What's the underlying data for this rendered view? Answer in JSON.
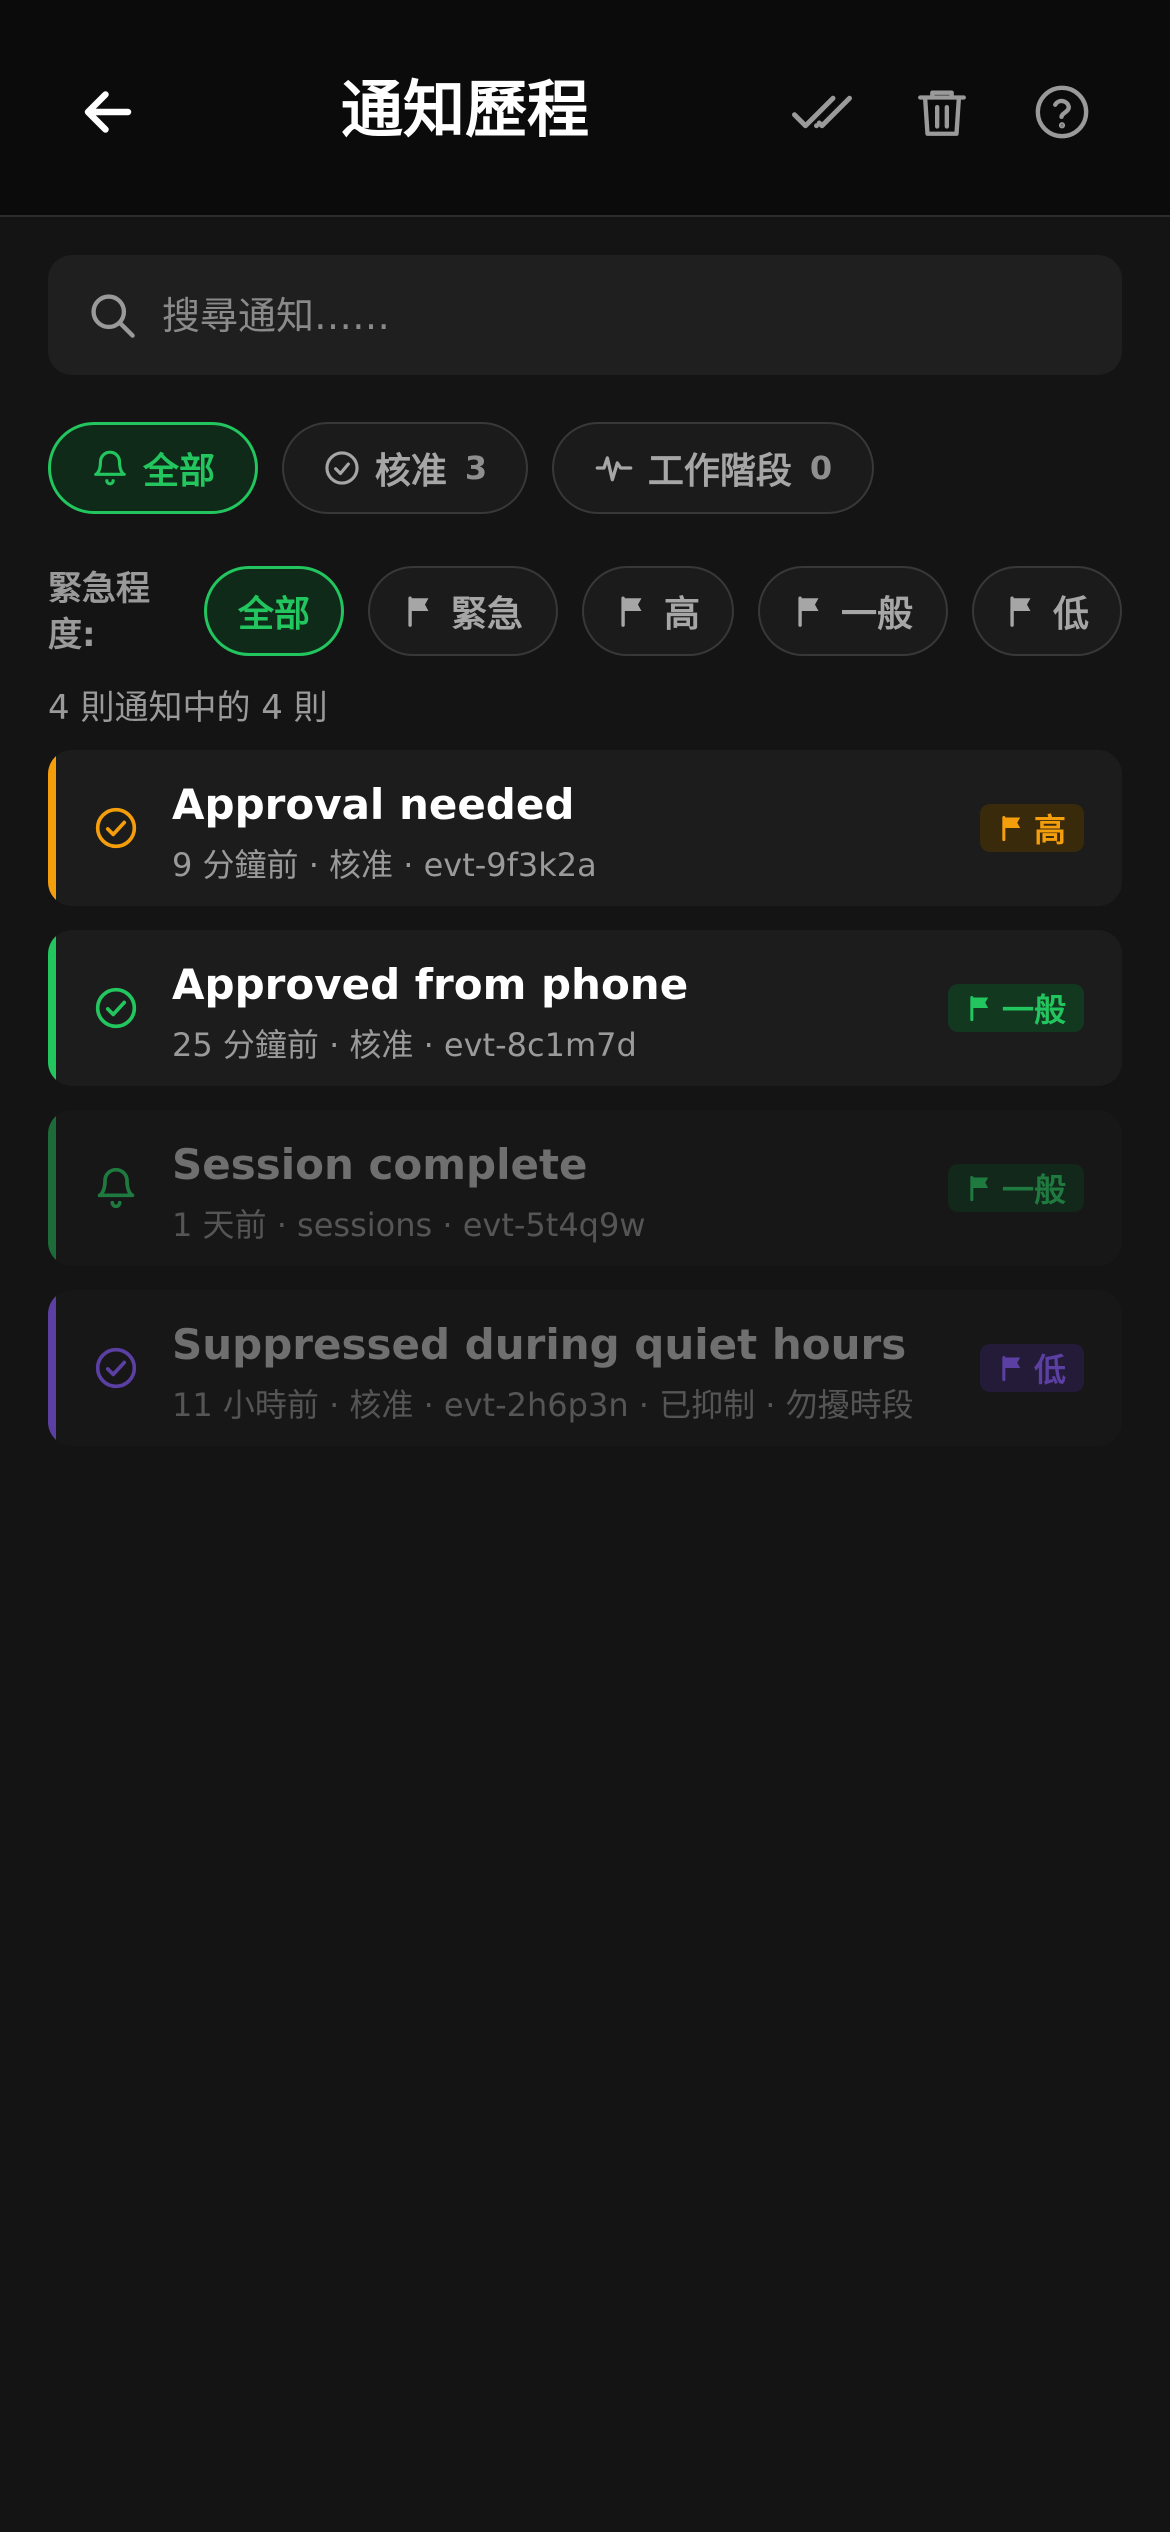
{
  "header": {
    "title": "通知歷程",
    "back_icon": "arrow-left-icon",
    "actions": [
      "mark-all-read-icon",
      "trash-icon",
      "help-icon"
    ]
  },
  "search": {
    "placeholder": "搜尋通知……",
    "value": ""
  },
  "type_filters": [
    {
      "label": "全部",
      "icon": "bell-icon",
      "count": "",
      "active": true
    },
    {
      "label": "核准",
      "icon": "check-circle-icon",
      "count": "3",
      "active": false
    },
    {
      "label": "工作階段",
      "icon": "activity-icon",
      "count": "0",
      "active": false
    }
  ],
  "urgency": {
    "label": "緊急程度:",
    "options": [
      {
        "label": "全部",
        "active": true
      },
      {
        "label": "緊急",
        "icon": "flag-icon"
      },
      {
        "label": "高",
        "icon": "flag-icon"
      },
      {
        "label": "一般",
        "icon": "flag-icon"
      },
      {
        "label": "低",
        "icon": "flag-icon"
      }
    ]
  },
  "summary": "4 則通知中的 4 則",
  "colors": {
    "accent": "#22c55e",
    "high": "#f59e0b",
    "normal": "#22c55e",
    "low": "#6d4bb8"
  },
  "notifications": [
    {
      "title": "Approval needed",
      "meta": "9 分鐘前 · 核准 · evt-9f3k2a",
      "icon": "check-circle-icon",
      "badge": "高",
      "level": "high",
      "read": false
    },
    {
      "title": "Approved from phone",
      "meta": "25 分鐘前 · 核准 · evt-8c1m7d",
      "icon": "check-circle-icon",
      "badge": "一般",
      "level": "normal",
      "read": false
    },
    {
      "title": "Session complete",
      "meta": "1 天前 · sessions · evt-5t4q9w",
      "icon": "bell-icon",
      "badge": "一般",
      "level": "normal",
      "read": true
    },
    {
      "title": "Suppressed during quiet hours",
      "meta": "11 小時前 · 核准 · evt-2h6p3n · 已抑制 · 勿擾時段",
      "icon": "check-circle-icon",
      "badge": "低",
      "level": "low",
      "read": true
    }
  ]
}
